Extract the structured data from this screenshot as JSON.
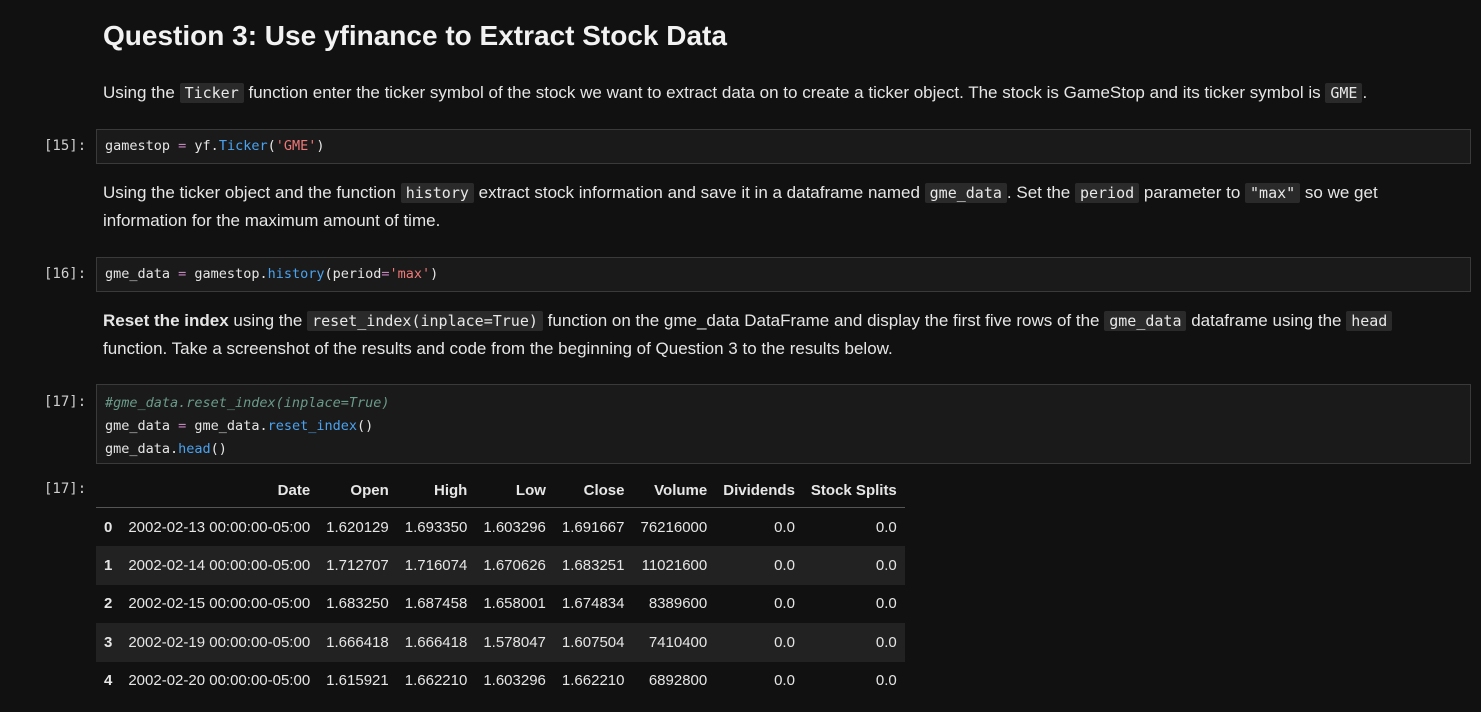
{
  "heading": "Question 3: Use yfinance to Extract Stock Data",
  "para1": {
    "t1": "Using the",
    "c1": "Ticker",
    "t2": "function enter the ticker symbol of the stock we want to extract data on to create a ticker object. The stock is GameStop and its ticker symbol is",
    "c2": "GME",
    "t3": "."
  },
  "cell15": {
    "prompt": "[15]:",
    "tokens": [
      "gamestop",
      " = ",
      "yf.",
      "Ticker",
      "(",
      "'GME'",
      ")"
    ]
  },
  "para2": {
    "t1": "Using the ticker object and the function",
    "c1": "history",
    "t2": "extract stock information and save it in a dataframe named",
    "c2": "gme_data",
    "t3": ". Set the",
    "c3": "period",
    "t4": "parameter to",
    "c4": "\"max\"",
    "t5": "so we get information for the maximum amount of time."
  },
  "cell16": {
    "prompt": "[16]:",
    "tokens": [
      "gme_data",
      " = ",
      "gamestop.",
      "history",
      "(period",
      "=",
      "'max'",
      ")"
    ]
  },
  "para3": {
    "b1": "Reset the index",
    "t1": "using the",
    "c1": "reset_index(inplace=True)",
    "t2": "function on the gme_data DataFrame and display the first five rows of the",
    "c2": "gme_data",
    "t3": "dataframe using the",
    "c3": "head",
    "t4": "function. Take a screenshot of the results and code from the beginning of Question 3 to the results below."
  },
  "cell17": {
    "prompt": "[17]:",
    "line1": "#gme_data.reset_index(inplace=True)",
    "line2_tokens": [
      "gme_data",
      " = ",
      "gme_data.",
      "reset_index",
      "()"
    ],
    "line3_tokens": [
      "gme_data.",
      "head",
      "()"
    ]
  },
  "output17": {
    "prompt": "[17]:",
    "columns": [
      "",
      "Date",
      "Open",
      "High",
      "Low",
      "Close",
      "Volume",
      "Dividends",
      "Stock Splits"
    ],
    "rows": [
      [
        "0",
        "2002-02-13 00:00:00-05:00",
        "1.620129",
        "1.693350",
        "1.603296",
        "1.691667",
        "76216000",
        "0.0",
        "0.0"
      ],
      [
        "1",
        "2002-02-14 00:00:00-05:00",
        "1.712707",
        "1.716074",
        "1.670626",
        "1.683251",
        "11021600",
        "0.0",
        "0.0"
      ],
      [
        "2",
        "2002-02-15 00:00:00-05:00",
        "1.683250",
        "1.687458",
        "1.658001",
        "1.674834",
        "8389600",
        "0.0",
        "0.0"
      ],
      [
        "3",
        "2002-02-19 00:00:00-05:00",
        "1.666418",
        "1.666418",
        "1.578047",
        "1.607504",
        "7410400",
        "0.0",
        "0.0"
      ],
      [
        "4",
        "2002-02-20 00:00:00-05:00",
        "1.615921",
        "1.662210",
        "1.603296",
        "1.662210",
        "6892800",
        "0.0",
        "0.0"
      ]
    ]
  }
}
